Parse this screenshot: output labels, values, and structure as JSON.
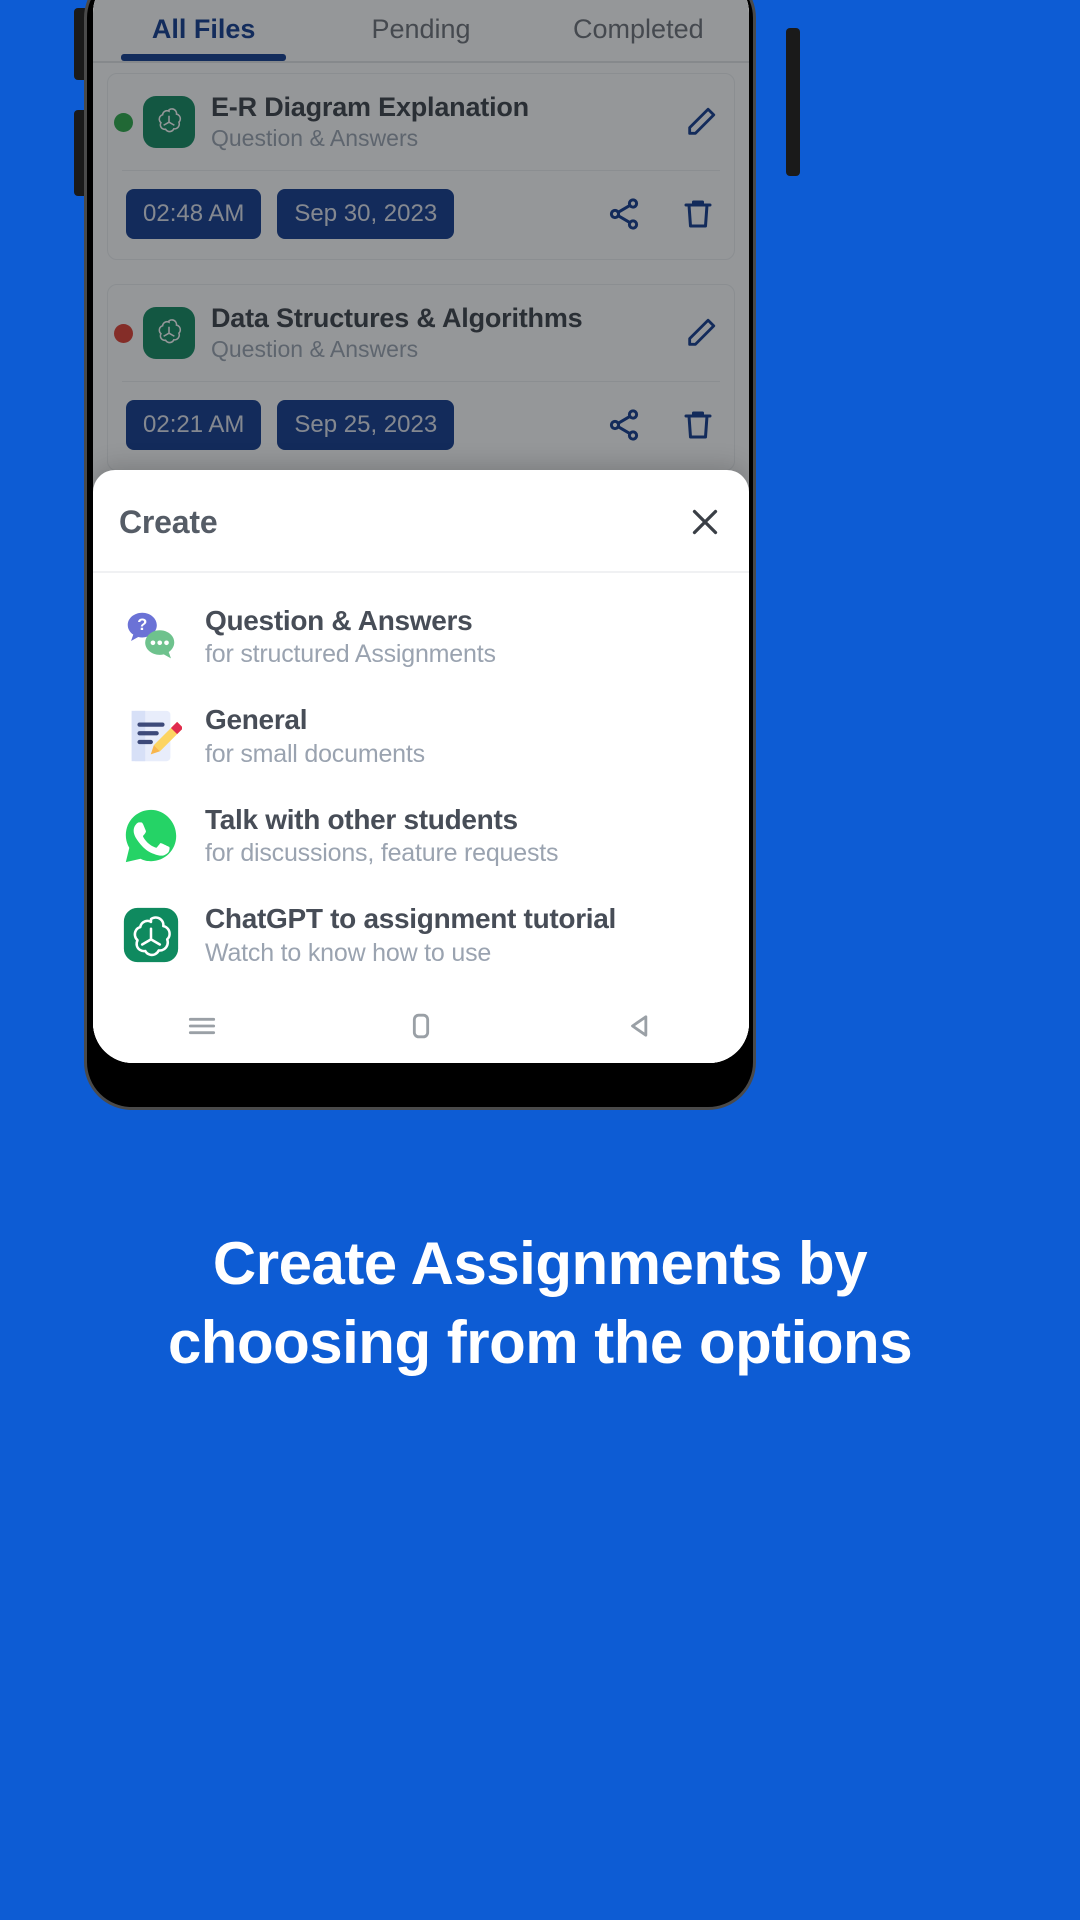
{
  "colors": {
    "brand_blue": "#0D5CD4",
    "tab_active": "#103a8e",
    "chip_bg": "#10398c",
    "gpt_green": "#0f8a5f",
    "status_green": "#2aa847",
    "status_red": "#e03b2f",
    "whatsapp_green": "#25D366"
  },
  "app": {
    "tabs": [
      {
        "label": "All Files",
        "active": true
      },
      {
        "label": "Pending",
        "active": false
      },
      {
        "label": "Completed",
        "active": false
      }
    ],
    "files": [
      {
        "status": "green",
        "icon": "chatgpt-icon",
        "title": "E-R Diagram Explanation",
        "subtitle": "Question & Answers",
        "time": "02:48 AM",
        "date": "Sep 30, 2023"
      },
      {
        "status": "red",
        "icon": "chatgpt-icon",
        "title": "Data Structures & Algorithms",
        "subtitle": "Question & Answers",
        "time": "02:21 AM",
        "date": "Sep 25, 2023"
      }
    ]
  },
  "sheet": {
    "title": "Create",
    "close_icon": "close-icon",
    "options": [
      {
        "icon": "question-answers-icon",
        "title": "Question & Answers",
        "subtitle": "for structured Assignments"
      },
      {
        "icon": "general-document-icon",
        "title": "General",
        "subtitle": "for small documents"
      },
      {
        "icon": "whatsapp-icon",
        "title": "Talk with other students",
        "subtitle": "for discussions, feature requests"
      },
      {
        "icon": "chatgpt-icon",
        "title": "ChatGPT to assignment tutorial",
        "subtitle": "Watch to know how to use"
      }
    ]
  },
  "navbar": {
    "items": [
      {
        "icon": "recents-menu-icon"
      },
      {
        "icon": "home-square-icon"
      },
      {
        "icon": "back-triangle-icon"
      }
    ]
  },
  "caption": {
    "line1": "Create Assignments by",
    "line2": "choosing from the options"
  }
}
